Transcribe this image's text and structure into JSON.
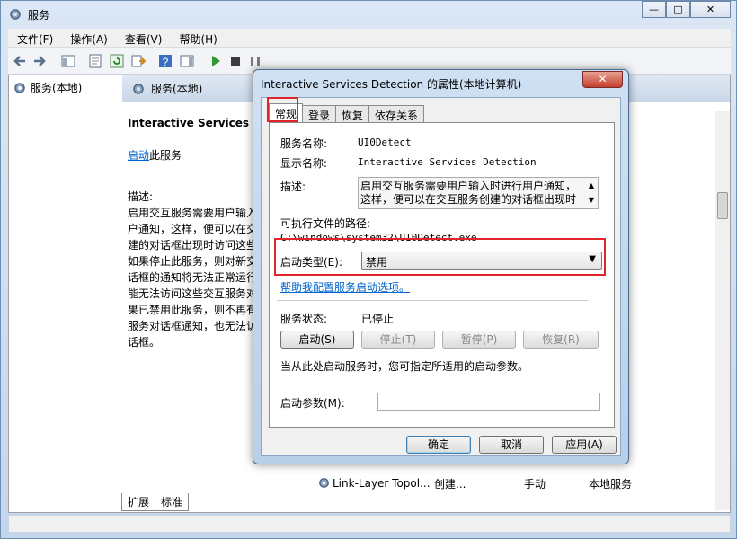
{
  "window": {
    "title": "服务",
    "menu": [
      "文件(F)",
      "操作(A)",
      "查看(V)",
      "帮助(H)"
    ]
  },
  "tree": {
    "root": "服务(本地)"
  },
  "panel": {
    "header": "服务(本地)",
    "service_name": "Interactive Services Detec",
    "start_link": "启动",
    "start_suffix": "此服务",
    "desc_label": "描述:",
    "desc_lines": [
      "启用交互服务需要用户输入",
      "户通知，这样，便可以在交",
      "建的对话框出现时访问这些",
      "如果停止此服务，则对新交",
      "话框的通知将无法正常运行",
      "能无法访问这些交互服务对",
      "果已禁用此服务，则不再有",
      "服务对话框通知，也无法访",
      "话框。"
    ],
    "bottom_row": {
      "name": "Link-Layer Topol...",
      "desc": "创建...",
      "start": "手动",
      "logon": "本地服务"
    },
    "tabs": [
      "扩展",
      "标准"
    ]
  },
  "dialog": {
    "title": "Interactive Services Detection 的属性(本地计算机)",
    "close": "✕",
    "tabs": [
      "常规",
      "登录",
      "恢复",
      "依存关系"
    ],
    "service_name_label": "服务名称:",
    "service_name_value": "UI0Detect",
    "display_name_label": "显示名称:",
    "display_name_value": "Interactive Services Detection",
    "desc_label": "描述:",
    "desc_value": "启用交互服务需要用户输入时进行用户通知，这样，便可以在交互服务创建的对话框出现时",
    "path_label": "可执行文件的路径:",
    "path_value": "C:\\windows\\system32\\UI0Detect.exe",
    "startup_type_label": "启动类型(E):",
    "startup_type_value": "禁用",
    "help_link": "帮助我配置服务启动选项。",
    "status_label": "服务状态:",
    "status_value": "已停止",
    "buttons": {
      "start": "启动(S)",
      "stop": "停止(T)",
      "pause": "暂停(P)",
      "resume": "恢复(R)"
    },
    "hint": "当从此处启动服务时，您可指定所适用的启动参数。",
    "param_label": "启动参数(M):",
    "param_value": "",
    "ok": "确定",
    "cancel": "取消",
    "apply": "应用(A)"
  },
  "colors": {
    "highlight": "#e0262a",
    "link": "#0066cc",
    "play": "#2f9a2f"
  }
}
